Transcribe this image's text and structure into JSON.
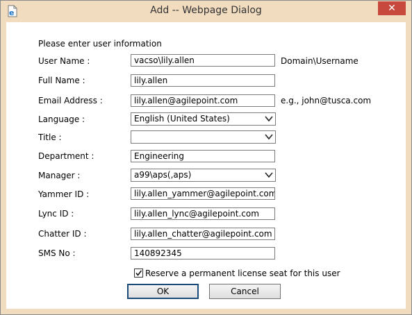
{
  "window": {
    "title": "Add -- Webpage Dialog",
    "close_label": "✕"
  },
  "form": {
    "heading": "Please enter user information",
    "fields": [
      {
        "label": "User Name :",
        "value": "vacso\\lily.allen",
        "hint": "Domain\\Username"
      },
      {
        "label": "Full Name :",
        "value": "lily.allen"
      },
      {
        "label": "Email Address :",
        "value": "lily.allen@agilepoint.com",
        "hint": "e.g., john@tusca.com"
      },
      {
        "label": "Language :",
        "value": "English (United States)"
      },
      {
        "label": "Title :",
        "value": ""
      },
      {
        "label": "Department :",
        "value": "Engineering"
      },
      {
        "label": "Manager :",
        "value": "a99\\aps(,aps)"
      },
      {
        "label": "Yammer ID :",
        "value": "lily.allen_yammer@agilepoint.com"
      },
      {
        "label": "Lync ID :",
        "value": "lily.allen_lync@agilepoint.com"
      },
      {
        "label": "Chatter ID :",
        "value": "lily.allen_chatter@agilepoint.com"
      },
      {
        "label": "SMS No :",
        "value": "140892345"
      }
    ],
    "reserve_seat": {
      "label": "Reserve a permanent license seat for this user",
      "checked": true
    }
  },
  "buttons": {
    "ok": "OK",
    "cancel": "Cancel"
  },
  "icons": {
    "app": "ie-page-icon",
    "close": "close-icon",
    "dropdown": "chevron-down-icon",
    "check": "checkmark-icon"
  }
}
